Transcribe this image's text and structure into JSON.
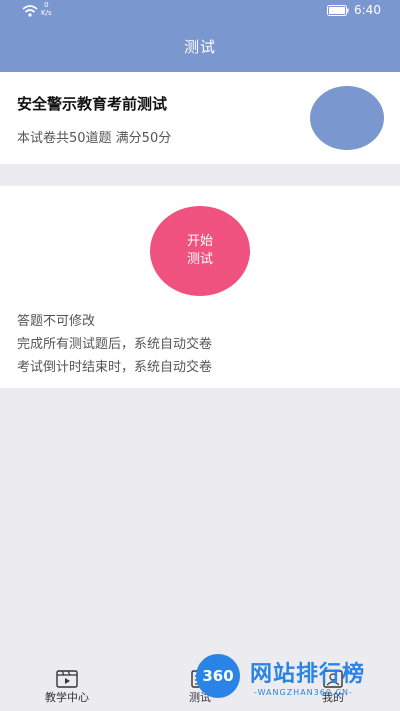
{
  "status_bar": {
    "net_speed_value": "0",
    "net_speed_unit": "K/s",
    "time": "6:40"
  },
  "header": {
    "title": "测试"
  },
  "exam": {
    "title": "安全警示教育考前测试",
    "subtitle": "本试卷共50道题  满分50分"
  },
  "start_button": {
    "line1": "开始",
    "line2": "测试"
  },
  "rules": [
    "答题不可修改",
    "完成所有测试题后，系统自动交卷",
    "考试倒计时结束时，系统自动交卷"
  ],
  "tabbar": {
    "items": [
      {
        "label": "教学中心",
        "icon": "video-icon"
      },
      {
        "label": "测试",
        "icon": "test-icon"
      },
      {
        "label": "我的",
        "icon": "profile-icon"
      }
    ]
  },
  "watermark": {
    "logo": "360",
    "text": "网站排行榜",
    "url": "-WANGZHAN360.CN-"
  },
  "colors": {
    "header": "#7b97d0",
    "start_button": "#ef527e",
    "avatar": "#7b97d0",
    "watermark": "#2a84e6"
  }
}
